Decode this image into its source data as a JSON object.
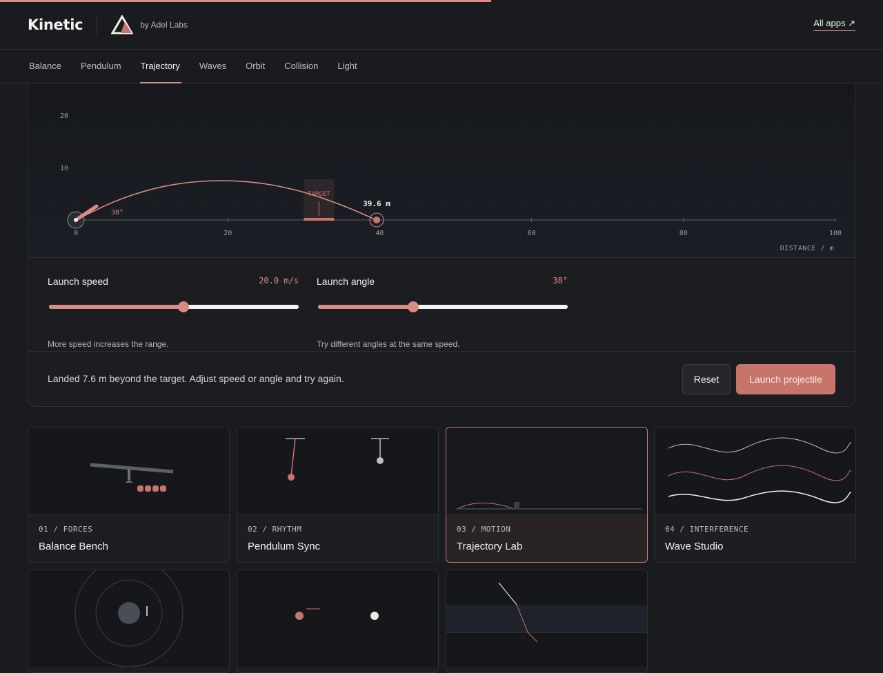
{
  "header": {
    "brand": "Kinetic",
    "lab_name": "by Adel Labs",
    "all_apps": "All apps ↗",
    "colors": {
      "accent": "#d98c84",
      "background": "#1a1b1e"
    }
  },
  "nav": {
    "tabs": [
      {
        "label": "Balance"
      },
      {
        "label": "Pendulum"
      },
      {
        "label": "Trajectory",
        "active": true
      },
      {
        "label": "Waves"
      },
      {
        "label": "Orbit"
      },
      {
        "label": "Collision"
      },
      {
        "label": "Light"
      }
    ]
  },
  "chart_data": {
    "type": "line",
    "x_ticks": [
      "0",
      "20",
      "40",
      "60",
      "80",
      "100"
    ],
    "y_ticks": [
      "10",
      "20"
    ],
    "xlim": [
      0,
      100
    ],
    "ylim": [
      0,
      20
    ],
    "xlabel": "DISTANCE / m",
    "launch_angle_label": "38°",
    "target_label": "TARGET",
    "target_range": [
      30,
      34
    ],
    "landing_label": "39.6 m",
    "landing_x": 39.6,
    "series": [
      {
        "x": [
          0,
          5,
          10,
          15,
          20,
          25,
          30,
          35,
          39.6
        ],
        "y": [
          0,
          3.6,
          6.0,
          7.3,
          7.6,
          7.0,
          5.4,
          2.9,
          0
        ]
      }
    ],
    "grid": true
  },
  "controls": {
    "speed": {
      "label": "Launch speed",
      "value": "20.0 m/s",
      "fraction": 0.54,
      "hint": "More speed increases the range."
    },
    "angle": {
      "label": "Launch angle",
      "value": "38°",
      "fraction": 0.38,
      "hint": "Try different angles at the same speed."
    }
  },
  "status": {
    "message": "Landed 7.6 m beyond the target. Adjust speed or angle and try again.",
    "reset_label": "Reset",
    "launch_label": "Launch projectile"
  },
  "apps": [
    {
      "meta": "01 / FORCES",
      "title": "Balance Bench"
    },
    {
      "meta": "02 / RHYTHM",
      "title": "Pendulum Sync"
    },
    {
      "meta": "03 / MOTION",
      "title": "Trajectory Lab",
      "active": true
    },
    {
      "meta": "04 / INTERFERENCE",
      "title": "Wave Studio"
    }
  ]
}
